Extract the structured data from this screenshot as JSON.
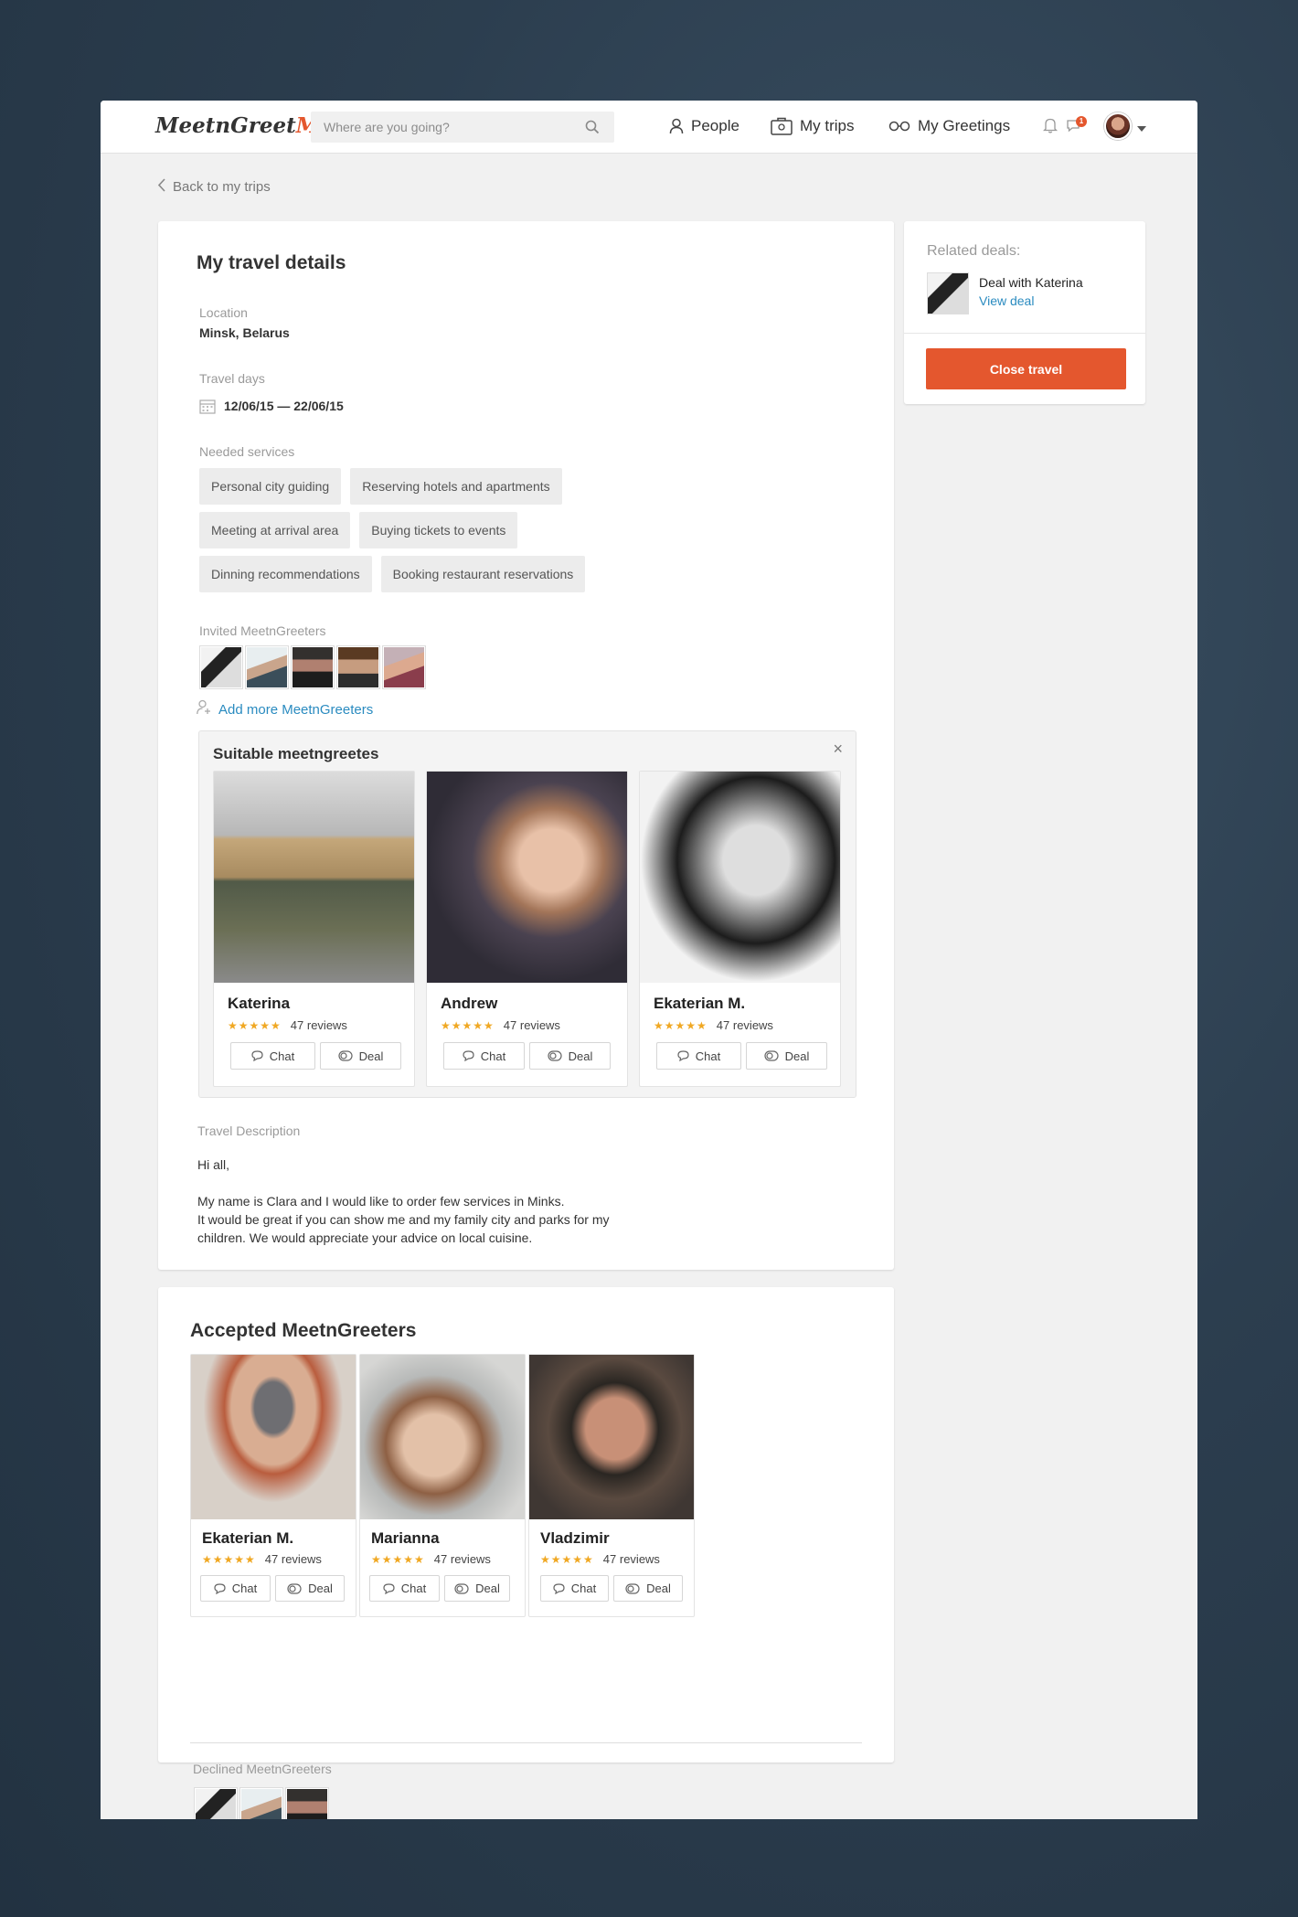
{
  "header": {
    "logo_part1": "MeetnGreet",
    "logo_part2": "Me",
    "search_placeholder": "Where are you going?",
    "nav": {
      "people": "People",
      "my_trips": "My trips",
      "my_greetings": "My Greetings"
    },
    "notification_count": "1"
  },
  "back_link": "Back to my trips",
  "details": {
    "title": "My travel details",
    "location_label": "Location",
    "location_value": "Minsk, Belarus",
    "travel_days_label": "Travel days",
    "travel_days_value": "12/06/15 — 22/06/15",
    "services_label": "Needed services",
    "services_rows": [
      [
        "Personal city guiding",
        "Reserving hotels and apartments"
      ],
      [
        "Meeting at arrival area",
        "Buying tickets to events"
      ],
      [
        "Dinning recommendations",
        "Booking restaurant reservations"
      ]
    ],
    "invited_label": "Invited MeetnGreeters",
    "add_more": "Add more MeetnGreeters"
  },
  "suitable": {
    "title": "Suitable meetngreetes",
    "close": "×",
    "people": [
      {
        "name": "Katerina",
        "reviews": "47 reviews",
        "chat": "Chat",
        "deal": "Deal"
      },
      {
        "name": "Andrew",
        "reviews": "47 reviews",
        "chat": "Chat",
        "deal": "Deal"
      },
      {
        "name": "Ekaterian M.",
        "reviews": "47 reviews",
        "chat": "Chat",
        "deal": "Deal"
      }
    ]
  },
  "description": {
    "label": "Travel Description",
    "greeting": "Hi all,",
    "line1": "My name is Clara and I would like to order few services in Minks.",
    "line2": "It would be great if you can show me and my family city and parks for my",
    "line3": "children. We would appreciate your advice on local cuisine."
  },
  "accepted": {
    "title": "Accepted MeetnGreeters",
    "people": [
      {
        "name": "Ekaterian M.",
        "reviews": "47 reviews",
        "chat": "Chat",
        "deal": "Deal"
      },
      {
        "name": "Marianna",
        "reviews": "47 reviews",
        "chat": "Chat",
        "deal": "Deal"
      },
      {
        "name": "Vladzimir",
        "reviews": "47 reviews",
        "chat": "Chat",
        "deal": "Deal"
      }
    ],
    "declined_label": "Declined MeetnGreeters"
  },
  "sidebar": {
    "related_label": "Related deals:",
    "deal_title": "Deal with Katerina",
    "view_deal": "View deal",
    "close_travel": "Close travel"
  },
  "stars": "★★★★★",
  "colors": {
    "accent": "#e4572e",
    "link": "#2a8bc0",
    "star": "#f0a823"
  }
}
